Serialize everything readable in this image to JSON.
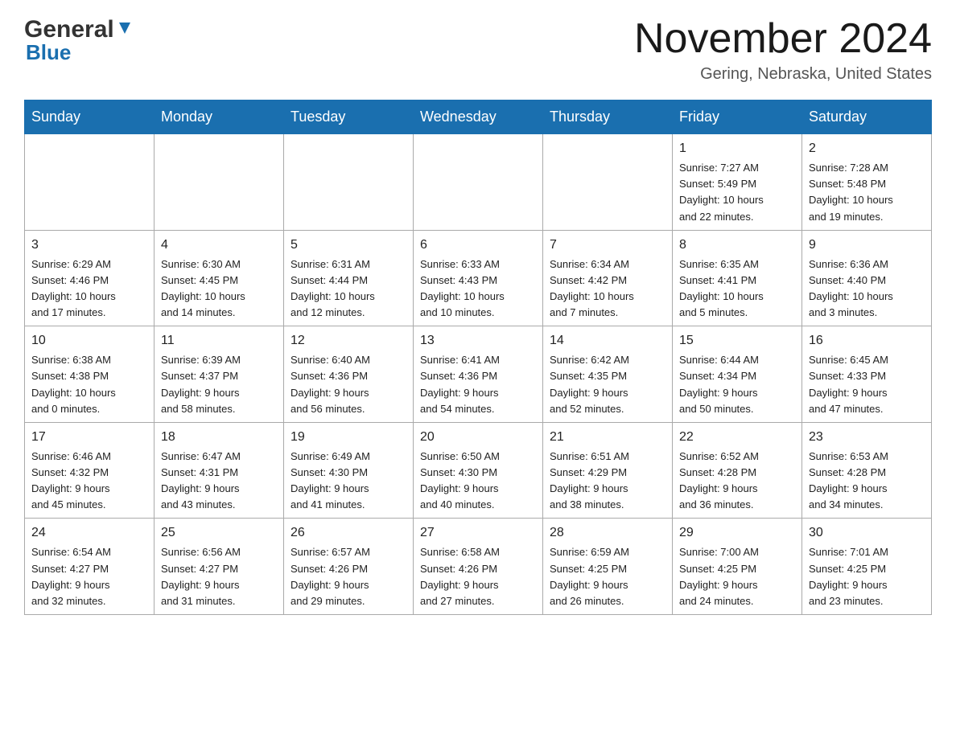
{
  "header": {
    "logo_general": "General",
    "logo_blue": "Blue",
    "month_title": "November 2024",
    "location": "Gering, Nebraska, United States"
  },
  "calendar": {
    "days_of_week": [
      "Sunday",
      "Monday",
      "Tuesday",
      "Wednesday",
      "Thursday",
      "Friday",
      "Saturday"
    ],
    "weeks": [
      [
        {
          "day": "",
          "info": ""
        },
        {
          "day": "",
          "info": ""
        },
        {
          "day": "",
          "info": ""
        },
        {
          "day": "",
          "info": ""
        },
        {
          "day": "",
          "info": ""
        },
        {
          "day": "1",
          "info": "Sunrise: 7:27 AM\nSunset: 5:49 PM\nDaylight: 10 hours\nand 22 minutes."
        },
        {
          "day": "2",
          "info": "Sunrise: 7:28 AM\nSunset: 5:48 PM\nDaylight: 10 hours\nand 19 minutes."
        }
      ],
      [
        {
          "day": "3",
          "info": "Sunrise: 6:29 AM\nSunset: 4:46 PM\nDaylight: 10 hours\nand 17 minutes."
        },
        {
          "day": "4",
          "info": "Sunrise: 6:30 AM\nSunset: 4:45 PM\nDaylight: 10 hours\nand 14 minutes."
        },
        {
          "day": "5",
          "info": "Sunrise: 6:31 AM\nSunset: 4:44 PM\nDaylight: 10 hours\nand 12 minutes."
        },
        {
          "day": "6",
          "info": "Sunrise: 6:33 AM\nSunset: 4:43 PM\nDaylight: 10 hours\nand 10 minutes."
        },
        {
          "day": "7",
          "info": "Sunrise: 6:34 AM\nSunset: 4:42 PM\nDaylight: 10 hours\nand 7 minutes."
        },
        {
          "day": "8",
          "info": "Sunrise: 6:35 AM\nSunset: 4:41 PM\nDaylight: 10 hours\nand 5 minutes."
        },
        {
          "day": "9",
          "info": "Sunrise: 6:36 AM\nSunset: 4:40 PM\nDaylight: 10 hours\nand 3 minutes."
        }
      ],
      [
        {
          "day": "10",
          "info": "Sunrise: 6:38 AM\nSunset: 4:38 PM\nDaylight: 10 hours\nand 0 minutes."
        },
        {
          "day": "11",
          "info": "Sunrise: 6:39 AM\nSunset: 4:37 PM\nDaylight: 9 hours\nand 58 minutes."
        },
        {
          "day": "12",
          "info": "Sunrise: 6:40 AM\nSunset: 4:36 PM\nDaylight: 9 hours\nand 56 minutes."
        },
        {
          "day": "13",
          "info": "Sunrise: 6:41 AM\nSunset: 4:36 PM\nDaylight: 9 hours\nand 54 minutes."
        },
        {
          "day": "14",
          "info": "Sunrise: 6:42 AM\nSunset: 4:35 PM\nDaylight: 9 hours\nand 52 minutes."
        },
        {
          "day": "15",
          "info": "Sunrise: 6:44 AM\nSunset: 4:34 PM\nDaylight: 9 hours\nand 50 minutes."
        },
        {
          "day": "16",
          "info": "Sunrise: 6:45 AM\nSunset: 4:33 PM\nDaylight: 9 hours\nand 47 minutes."
        }
      ],
      [
        {
          "day": "17",
          "info": "Sunrise: 6:46 AM\nSunset: 4:32 PM\nDaylight: 9 hours\nand 45 minutes."
        },
        {
          "day": "18",
          "info": "Sunrise: 6:47 AM\nSunset: 4:31 PM\nDaylight: 9 hours\nand 43 minutes."
        },
        {
          "day": "19",
          "info": "Sunrise: 6:49 AM\nSunset: 4:30 PM\nDaylight: 9 hours\nand 41 minutes."
        },
        {
          "day": "20",
          "info": "Sunrise: 6:50 AM\nSunset: 4:30 PM\nDaylight: 9 hours\nand 40 minutes."
        },
        {
          "day": "21",
          "info": "Sunrise: 6:51 AM\nSunset: 4:29 PM\nDaylight: 9 hours\nand 38 minutes."
        },
        {
          "day": "22",
          "info": "Sunrise: 6:52 AM\nSunset: 4:28 PM\nDaylight: 9 hours\nand 36 minutes."
        },
        {
          "day": "23",
          "info": "Sunrise: 6:53 AM\nSunset: 4:28 PM\nDaylight: 9 hours\nand 34 minutes."
        }
      ],
      [
        {
          "day": "24",
          "info": "Sunrise: 6:54 AM\nSunset: 4:27 PM\nDaylight: 9 hours\nand 32 minutes."
        },
        {
          "day": "25",
          "info": "Sunrise: 6:56 AM\nSunset: 4:27 PM\nDaylight: 9 hours\nand 31 minutes."
        },
        {
          "day": "26",
          "info": "Sunrise: 6:57 AM\nSunset: 4:26 PM\nDaylight: 9 hours\nand 29 minutes."
        },
        {
          "day": "27",
          "info": "Sunrise: 6:58 AM\nSunset: 4:26 PM\nDaylight: 9 hours\nand 27 minutes."
        },
        {
          "day": "28",
          "info": "Sunrise: 6:59 AM\nSunset: 4:25 PM\nDaylight: 9 hours\nand 26 minutes."
        },
        {
          "day": "29",
          "info": "Sunrise: 7:00 AM\nSunset: 4:25 PM\nDaylight: 9 hours\nand 24 minutes."
        },
        {
          "day": "30",
          "info": "Sunrise: 7:01 AM\nSunset: 4:25 PM\nDaylight: 9 hours\nand 23 minutes."
        }
      ]
    ]
  }
}
